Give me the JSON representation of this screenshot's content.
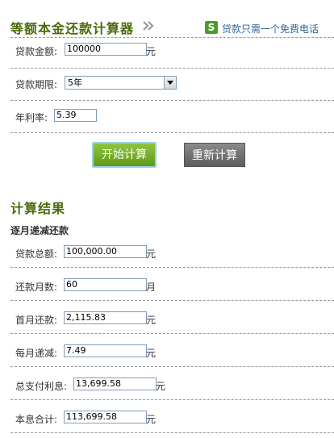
{
  "header": {
    "title": "等额本金还款计算器",
    "arrow_icon": "double-chevron-right-icon",
    "hotline_icon": "phone-logo-icon",
    "hotline_icon_glyph": "S",
    "hotline_text": "贷款只需一个免费电话"
  },
  "form": {
    "amount_label": "贷款金额:",
    "amount_value": "100000",
    "amount_unit": "元",
    "term_label": "贷款期限:",
    "term_value": "5年",
    "rate_label": "年利率:",
    "rate_value": "5.39"
  },
  "buttons": {
    "start_label": "开始计算",
    "reset_label": "重新计算"
  },
  "results": {
    "title": "计算结果",
    "subtitle": "逐月递减还款",
    "total_loan_label": "贷款总额:",
    "total_loan_value": "100,000.00",
    "total_loan_unit": "元",
    "months_label": "还款月数:",
    "months_value": "60",
    "months_unit": "月",
    "first_month_label": "首月还款:",
    "first_month_value": "2,115.83",
    "first_month_unit": "元",
    "monthly_decrease_label": "每月递减:",
    "monthly_decrease_value": "7.49",
    "monthly_decrease_unit": "元",
    "total_interest_label": "总支付利息:",
    "total_interest_value": "13,699.58",
    "total_interest_unit": "元",
    "total_sum_label": "本息合计:",
    "total_sum_value": "113,699.58",
    "total_sum_unit": "元"
  },
  "colors": {
    "title": "#4a6b0a",
    "start_button": "#6fa82a",
    "reset_button": "#707070",
    "hotline_text": "#336699",
    "dash": "#999999"
  }
}
